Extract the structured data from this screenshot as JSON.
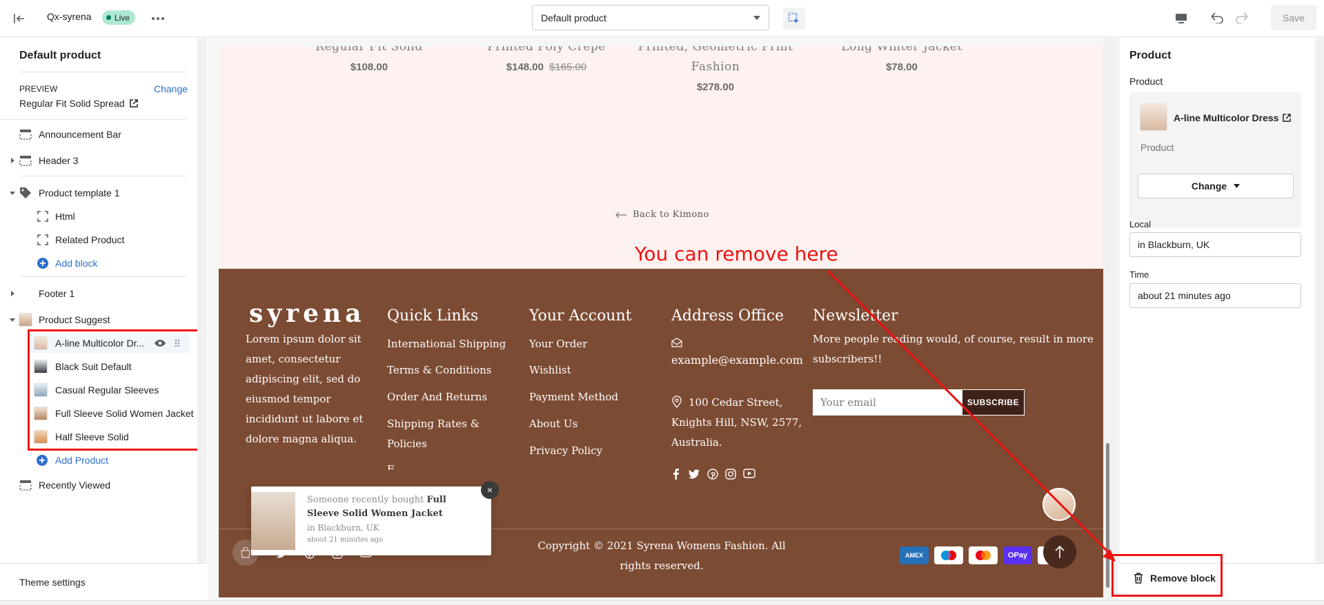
{
  "topbar": {
    "store_name": "Qx-syrena",
    "status_badge": "Live",
    "template_select": "Default product",
    "save_label": "Save"
  },
  "left_panel": {
    "title": "Default product",
    "preview_label": "PREVIEW",
    "preview_change": "Change",
    "preview_value": "Regular Fit Solid Spread",
    "sections": {
      "announcement": "Announcement Bar",
      "header": "Header 3",
      "product_template": "Product template 1",
      "html": "Html",
      "related": "Related Product",
      "add_block": "Add block",
      "footer": "Footer 1",
      "product_suggest": "Product Suggest",
      "add_product": "Add Product",
      "recently_viewed": "Recently Viewed"
    },
    "suggest_items": [
      "A-line Multicolor Dr...",
      "Black Suit Default",
      "Casual Regular Sleeves",
      "Full Sleeve Solid Women Jacket",
      "Half Sleeve Solid"
    ],
    "theme_settings": "Theme settings"
  },
  "preview": {
    "products": [
      {
        "name": "Regular Fit Solid",
        "price": "$108.00",
        "compare": ""
      },
      {
        "name": "Printed Poly Crepe",
        "price": "$148.00",
        "compare": "$165.00"
      },
      {
        "name": "Printed, Geometric Print",
        "name2": "Fashion",
        "price": "$278.00",
        "compare": ""
      },
      {
        "name": "Long Winter Jacket",
        "price": "$78.00",
        "compare": ""
      }
    ],
    "back_link": "Back to Kimono",
    "annotation": "You can remove here",
    "footer": {
      "logo": "syrena",
      "about_lines": [
        "Lorem ipsum dolor sit",
        "amet, consectetur",
        "adipiscing elit, sed do",
        "eiusmod tempor",
        "incididunt ut labore et",
        "dolore magna aliqua."
      ],
      "quick_links_title": "Quick Links",
      "quick_links": [
        "International Shipping",
        "Terms & Conditions",
        "Order And Returns",
        "Shipping Rates &",
        "Policies",
        "F..."
      ],
      "account_title": "Your Account",
      "account_links": [
        "Your Order",
        "Wishlist",
        "Payment Method",
        "About Us",
        "Privacy Policy"
      ],
      "address_title": "Address Office",
      "address_email": "example@example.com",
      "address_lines": [
        "100 Cedar Street,",
        "Knights Hill, NSW, 2577,",
        "Australia."
      ],
      "newsletter_title": "Newsletter",
      "newsletter_lines": [
        "More people reading would, of course, result in more",
        "subscribers!!"
      ],
      "email_placeholder": "Your email",
      "subscribe": "SUBSCRIBE",
      "copyright_lines": [
        "Copyright © 2021 Syrena Womens Fashion. All",
        "rights reserved."
      ],
      "payments": [
        "AMEX",
        "Maestro",
        "Mastercard",
        "OPay",
        "Visa"
      ]
    },
    "popup": {
      "lead": "Someone recently bought",
      "product": "Full Sleeve Solid Women Jacket",
      "location": "in Blackburn, UK",
      "time": "about 21 minutes ago",
      "close": "×"
    }
  },
  "right_panel": {
    "title": "Product",
    "product_label": "Product",
    "product_name": "A-line Multicolor Dress",
    "product_sub": "Product",
    "change_label": "Change",
    "local_label": "Local",
    "local_value": "in Blackburn, UK",
    "time_label": "Time",
    "time_value": "about 21 minutes ago",
    "remove_label": "Remove block"
  },
  "colors": {
    "accent": "#2c6ecb",
    "annotation_red": "#ee1111",
    "footer_bg": "#7c4b34",
    "preview_bg": "#fdf2ef"
  }
}
